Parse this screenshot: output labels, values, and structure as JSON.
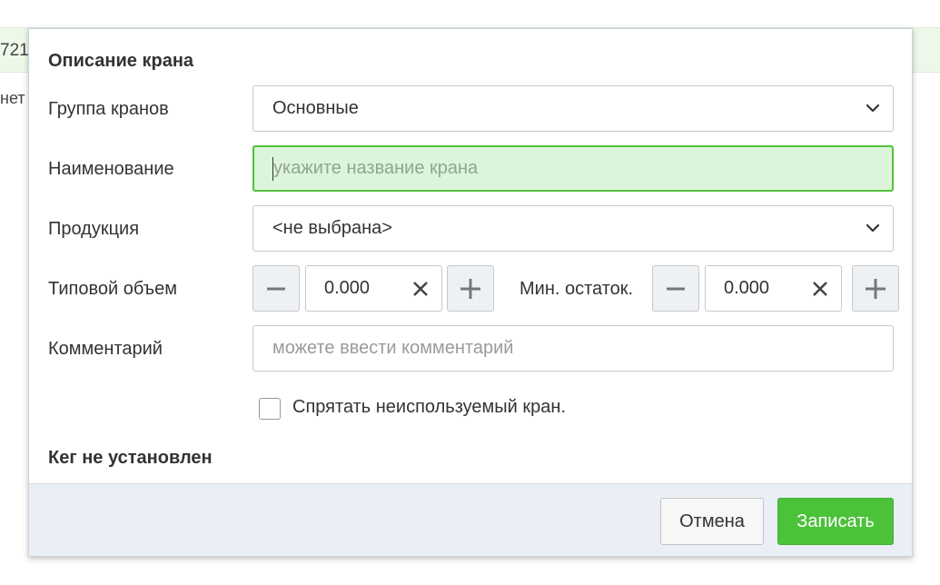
{
  "background": {
    "row_fragment": "721",
    "cell_fragment": "нет"
  },
  "dialog": {
    "title": "Описание крана",
    "group": {
      "label": "Группа кранов",
      "selected": "Основные"
    },
    "name": {
      "label": "Наименование",
      "value": "",
      "placeholder": "укажите название крана"
    },
    "product": {
      "label": "Продукция",
      "selected": "<не выбрана>"
    },
    "typical_volume": {
      "label": "Типовой объем",
      "value": "0.000"
    },
    "min_stock": {
      "label": "Мин. остаток.",
      "value": "0.000"
    },
    "comment": {
      "label": "Комментарий",
      "value": "",
      "placeholder": "можете ввести комментарий"
    },
    "hide_unused": {
      "label": "Спрятать неиспользуемый кран.",
      "checked": false
    },
    "keg_status": "Кег не установлен",
    "footer": {
      "cancel_label": "Отмена",
      "save_label": "Записать"
    }
  },
  "colors": {
    "accent_green": "#4cc13a",
    "name_field_bg": "#dcf5da",
    "name_field_border": "#52c23c",
    "footer_bg": "#eaeff5"
  },
  "icons": {
    "dropdown": "chevron-down-icon",
    "decrement": "minus-icon",
    "increment": "plus-icon",
    "clear": "close-icon"
  }
}
